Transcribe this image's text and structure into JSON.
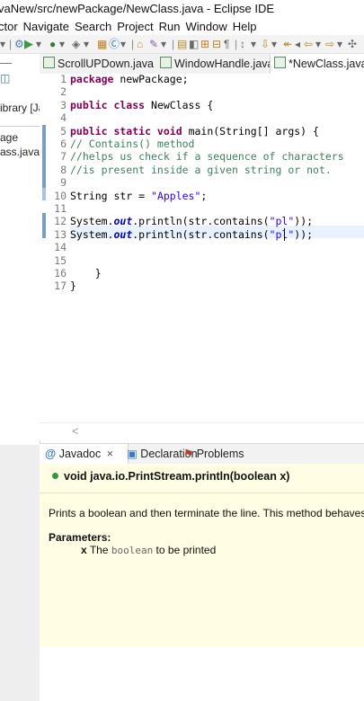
{
  "window": {
    "title": "vaNew/src/newPackage/NewClass.java - Eclipse IDE"
  },
  "menu": [
    "ctor",
    "Navigate",
    "Search",
    "Project",
    "Run",
    "Window",
    "Help"
  ],
  "left_panel": {
    "rows": [
      "ibrary [Ja",
      "age",
      "ass.java"
    ]
  },
  "editor_tabs": [
    {
      "label": "ScrollUPDown.java",
      "active": false
    },
    {
      "label": "WindowHandle.java",
      "active": false
    },
    {
      "label": "*NewClass.java",
      "active": true
    }
  ],
  "line_numbers": [
    "1",
    "2",
    "3",
    "4",
    "5",
    "6",
    "7",
    "8",
    "9",
    "10",
    "11",
    "12",
    "13",
    "14",
    "15",
    "16",
    "17"
  ],
  "code_lines": [
    [
      {
        "t": "package ",
        "c": "kw"
      },
      {
        "t": "newPackage;",
        "c": ""
      }
    ],
    [],
    [
      {
        "t": "public class ",
        "c": "kw"
      },
      {
        "t": "NewClass {",
        "c": ""
      }
    ],
    [],
    [
      {
        "t": "public static void ",
        "c": "kw"
      },
      {
        "t": "main(String[] args) {",
        "c": ""
      }
    ],
    [
      {
        "t": "// Contains() method",
        "c": "cm"
      }
    ],
    [
      {
        "t": "//helps us check if a sequence of characters",
        "c": "cm"
      }
    ],
    [
      {
        "t": "//is present inside a given string or not.",
        "c": "cm"
      }
    ],
    [],
    [
      {
        "t": "String str = ",
        "c": ""
      },
      {
        "t": "\"Apples\"",
        "c": "st"
      },
      {
        "t": ";",
        "c": ""
      }
    ],
    [],
    [
      {
        "t": "System.",
        "c": ""
      },
      {
        "t": "out",
        "c": "fld"
      },
      {
        "t": ".println(str.contains(",
        "c": ""
      },
      {
        "t": "\"pl\"",
        "c": "st"
      },
      {
        "t": "));",
        "c": ""
      }
    ],
    [
      {
        "t": "System.",
        "c": ""
      },
      {
        "t": "out",
        "c": "fld"
      },
      {
        "t": ".println(str.contains(",
        "c": ""
      },
      {
        "t": "\"pl\"",
        "c": "st"
      },
      {
        "t": "));",
        "c": ""
      }
    ],
    [],
    [],
    [
      {
        "t": "    }",
        "c": ""
      }
    ],
    [
      {
        "t": "}",
        "c": ""
      }
    ]
  ],
  "bottom_tabs": [
    {
      "label": "Javadoc",
      "active": true,
      "close": "×"
    },
    {
      "label": "Declaration",
      "active": false
    },
    {
      "label": "Problems",
      "active": false
    }
  ],
  "javadoc": {
    "signature": "void java.io.PrintStream.println(boolean x)",
    "description": "Prints a boolean and then terminate the line. This method behaves as th",
    "params_heading": "Parameters:",
    "param_name": "x",
    "param_text_pre": "The",
    "param_code": "boolean",
    "param_text_post": "to be printed"
  },
  "colors": {
    "keyword": "#7f0055",
    "comment": "#3f7f5f",
    "string": "#2a00ff",
    "field": "#0000c0",
    "javadoc_bg": "#fffee4"
  }
}
